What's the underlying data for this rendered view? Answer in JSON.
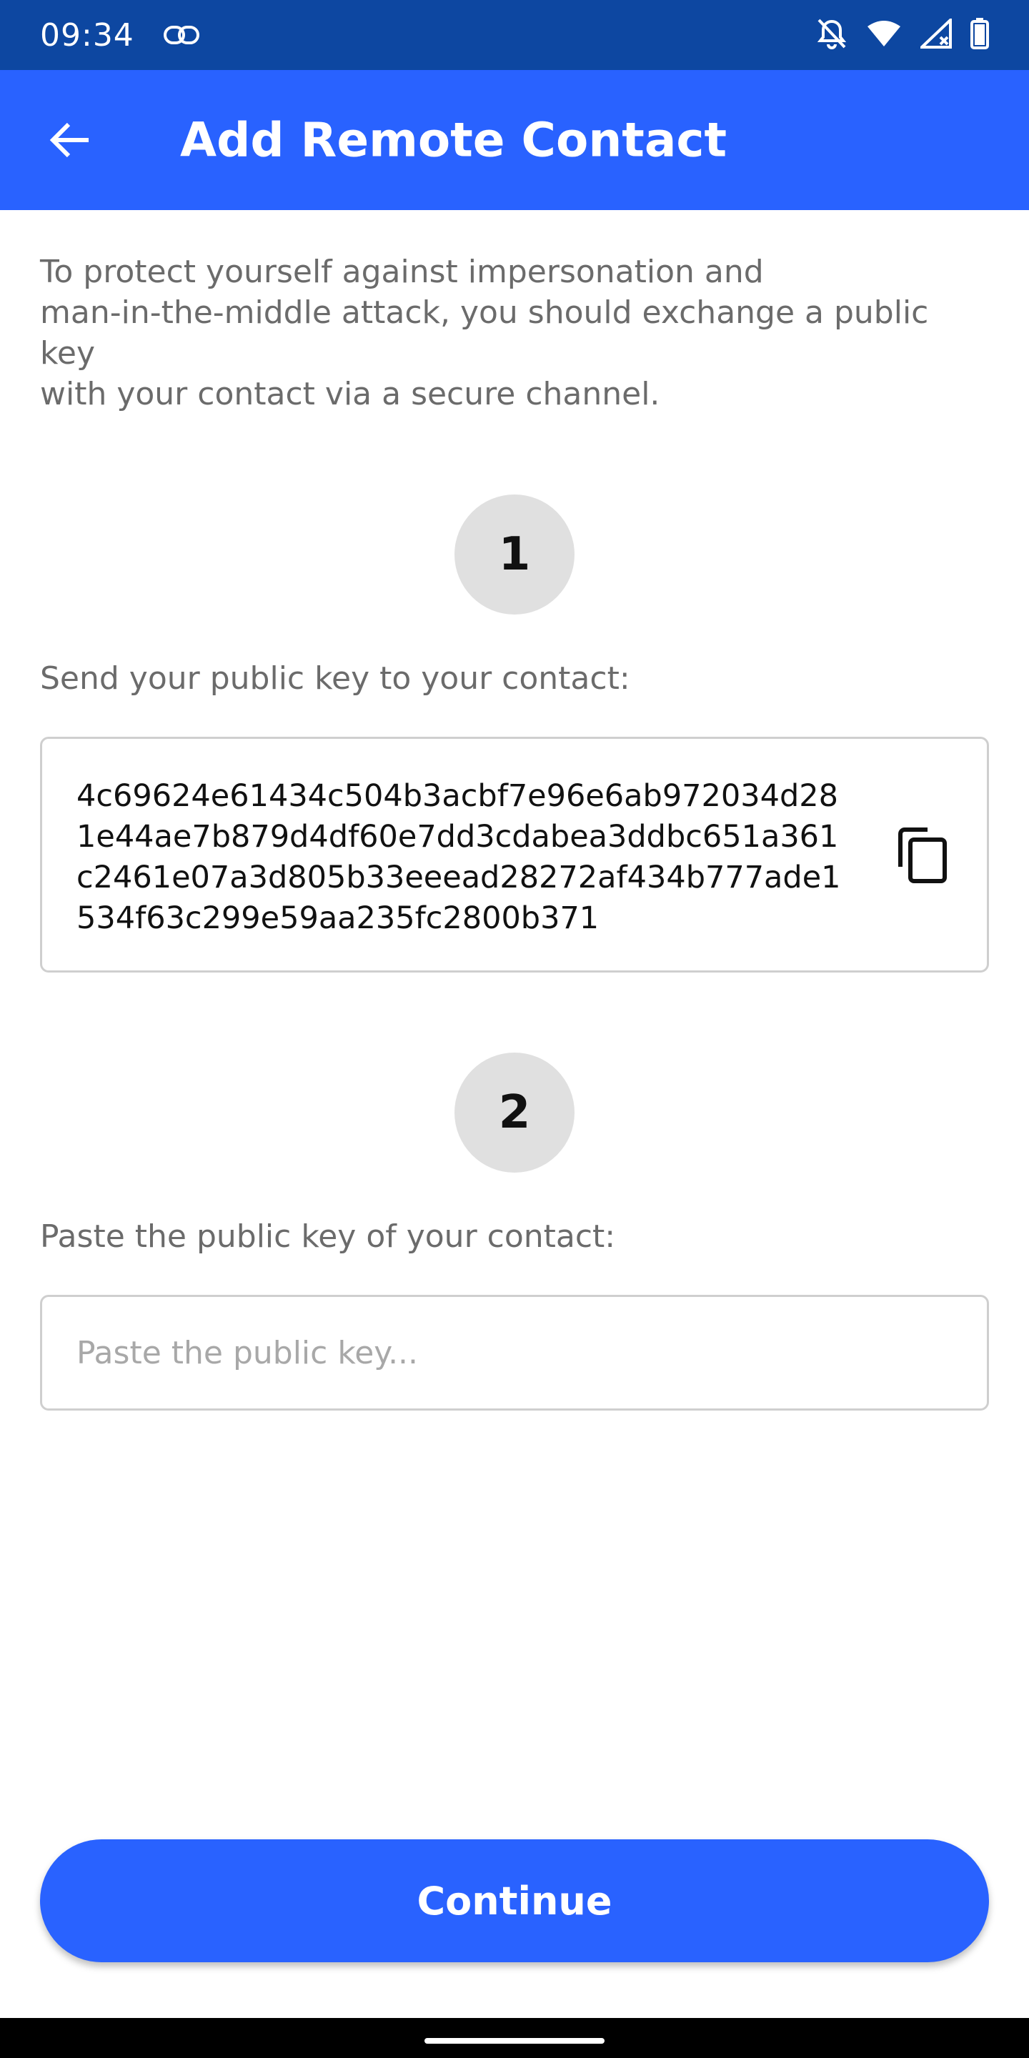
{
  "status_bar": {
    "time": "09:34",
    "icons": [
      "link-icon",
      "notifications-off-icon",
      "wifi-icon",
      "cellular-signal-icon",
      "battery-icon"
    ]
  },
  "app_bar": {
    "title": "Add Remote Contact",
    "back_icon": "arrow-back-icon"
  },
  "intro_text": "To protect yourself against impersonation and\nman-in-the-middle attack, you should exchange a public key\nwith your contact via a secure channel.",
  "step1": {
    "number": "1",
    "label": "Send your public key to your contact:",
    "public_key": "4c69624e61434c504b3acbf7e96e6ab972034d281e44ae7b879d4df60e7dd3cdabea3ddbc651a361c2461e07a3d805b33eeead28272af434b777ade1534f63c299e59aa235fc2800b371",
    "copy_icon": "copy-icon"
  },
  "step2": {
    "number": "2",
    "label": "Paste the public key of your contact:",
    "input_value": "",
    "input_placeholder": "Paste the public key..."
  },
  "continue_label": "Continue",
  "colors": {
    "status_bar": "#0d47a1",
    "primary": "#2962ff",
    "step_circle": "#e0e0e0",
    "secondary_text": "#6b6b6b",
    "border": "#cfcfcf"
  }
}
